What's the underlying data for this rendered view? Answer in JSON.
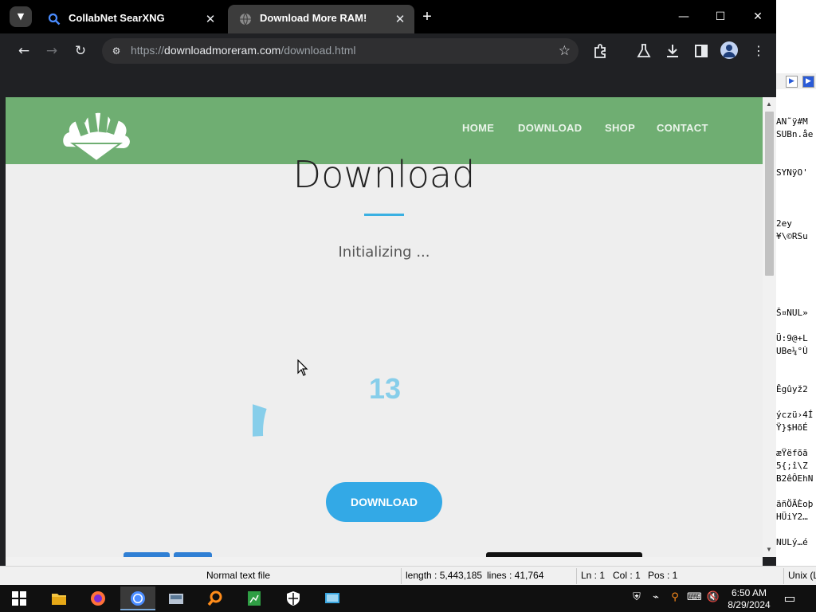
{
  "browser": {
    "tabs": [
      {
        "title": "CollabNet SearXNG",
        "active": false
      },
      {
        "title": "Download More RAM!",
        "active": true
      }
    ],
    "url_scheme": "https://",
    "url_host": "downloadmoreram.com",
    "url_path": "/download.html"
  },
  "site": {
    "menu": [
      "HOME",
      "DOWNLOAD",
      "SHOP",
      "CONTACT"
    ],
    "title": "Download",
    "status": "Initializing ...",
    "button": "DOWNLOAD",
    "colors": {
      "header": "#6fae72",
      "accent": "#33a9e6",
      "progress": "#87ceea"
    }
  },
  "progress": {
    "percent": 13,
    "label": "13"
  },
  "notepad": {
    "lines": [
      "AN˜ÿ#M",
      "SUBn.åe",
      "SYNÿO'",
      "2ey",
      "¥\\©RSu",
      "Š¤NUL»",
      "Ü:9@+L",
      "UBe¼°Ù",
      "Êgûyž2",
      "ýczü›4Í",
      "Ÿ}$HõÉ",
      "æŸëfõã",
      "5{;î\\Z",
      "B2êÔEhN",
      "äñÖÃÈoþ",
      "HÜiY2…",
      "NULý…é"
    ],
    "status": {
      "type": "Normal text file",
      "length": "length : 5,443,185",
      "lines": "lines : 41,764",
      "ln": "Ln : 1",
      "col": "Col : 1",
      "pos": "Pos : 1",
      "eol": "Unix (L"
    }
  },
  "taskbar": {
    "time": "6:50 AM",
    "date": "8/29/2024",
    "apps": [
      "windows-start",
      "file-explorer",
      "firefox",
      "chrome",
      "disk-utility",
      "search-tool",
      "spreadsheet",
      "security",
      "remote-desktop"
    ]
  }
}
